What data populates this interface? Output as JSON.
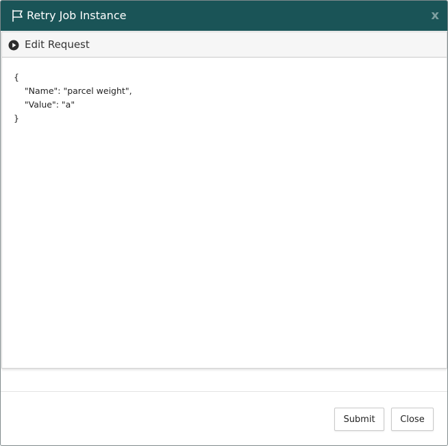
{
  "dialog": {
    "title": "Retry Job Instance",
    "close_glyph": "x",
    "flag_icon": "flag-icon"
  },
  "section": {
    "label": "Edit Request",
    "icon": "play-circle-icon"
  },
  "editor": {
    "content": "{\n    \"Name\": \"parcel weight\",\n    \"Value\": \"a\"\n}"
  },
  "footer": {
    "submit_label": "Submit",
    "close_label": "Close"
  },
  "colors": {
    "titlebar": "#1a5457",
    "close_glyph": "#7ea0a1",
    "section_header": "#f6f6f6"
  }
}
